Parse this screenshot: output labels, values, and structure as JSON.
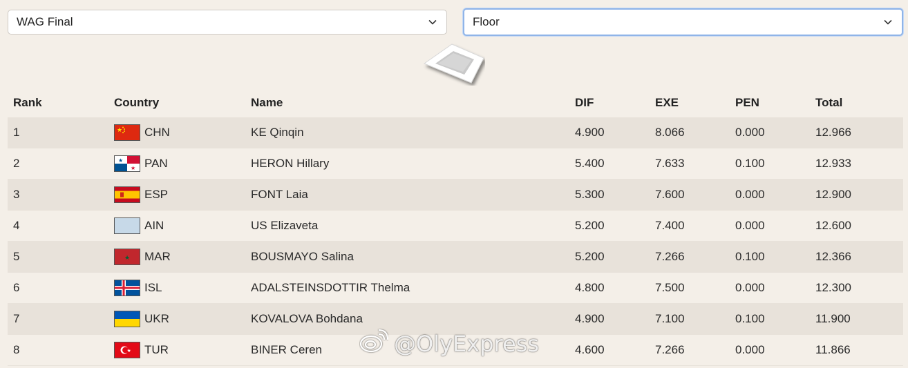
{
  "selects": {
    "competition": "WAG Final",
    "apparatus": "Floor"
  },
  "table": {
    "headers": [
      "Rank",
      "Country",
      "Name",
      "DIF",
      "EXE",
      "PEN",
      "Total"
    ],
    "rows": [
      {
        "rank": "1",
        "code": "CHN",
        "flag": "chn",
        "name": "KE Qinqin",
        "dif": "4.900",
        "exe": "8.066",
        "pen": "0.000",
        "total": "12.966"
      },
      {
        "rank": "2",
        "code": "PAN",
        "flag": "pan",
        "name": "HERON Hillary",
        "dif": "5.400",
        "exe": "7.633",
        "pen": "0.100",
        "total": "12.933"
      },
      {
        "rank": "3",
        "code": "ESP",
        "flag": "esp",
        "name": "FONT Laia",
        "dif": "5.300",
        "exe": "7.600",
        "pen": "0.000",
        "total": "12.900"
      },
      {
        "rank": "4",
        "code": "AIN",
        "flag": "ain",
        "name": "US Elizaveta",
        "dif": "5.200",
        "exe": "7.400",
        "pen": "0.000",
        "total": "12.600"
      },
      {
        "rank": "5",
        "code": "MAR",
        "flag": "mar",
        "name": "BOUSMAYO Salina",
        "dif": "5.200",
        "exe": "7.266",
        "pen": "0.100",
        "total": "12.366"
      },
      {
        "rank": "6",
        "code": "ISL",
        "flag": "isl",
        "name": "ADALSTEINSDOTTIR Thelma",
        "dif": "4.800",
        "exe": "7.500",
        "pen": "0.000",
        "total": "12.300"
      },
      {
        "rank": "7",
        "code": "UKR",
        "flag": "ukr",
        "name": "KOVALOVA Bohdana",
        "dif": "4.900",
        "exe": "7.100",
        "pen": "0.100",
        "total": "11.900"
      },
      {
        "rank": "8",
        "code": "TUR",
        "flag": "tur",
        "name": "BINER Ceren",
        "dif": "4.600",
        "exe": "7.266",
        "pen": "0.000",
        "total": "11.866"
      }
    ]
  },
  "watermark": "@OlyExpress",
  "icons": {
    "dropdown": "chevron-down-icon",
    "apparatus_graphic": "floor-mat-icon",
    "watermark_logo": "weibo-logo"
  }
}
